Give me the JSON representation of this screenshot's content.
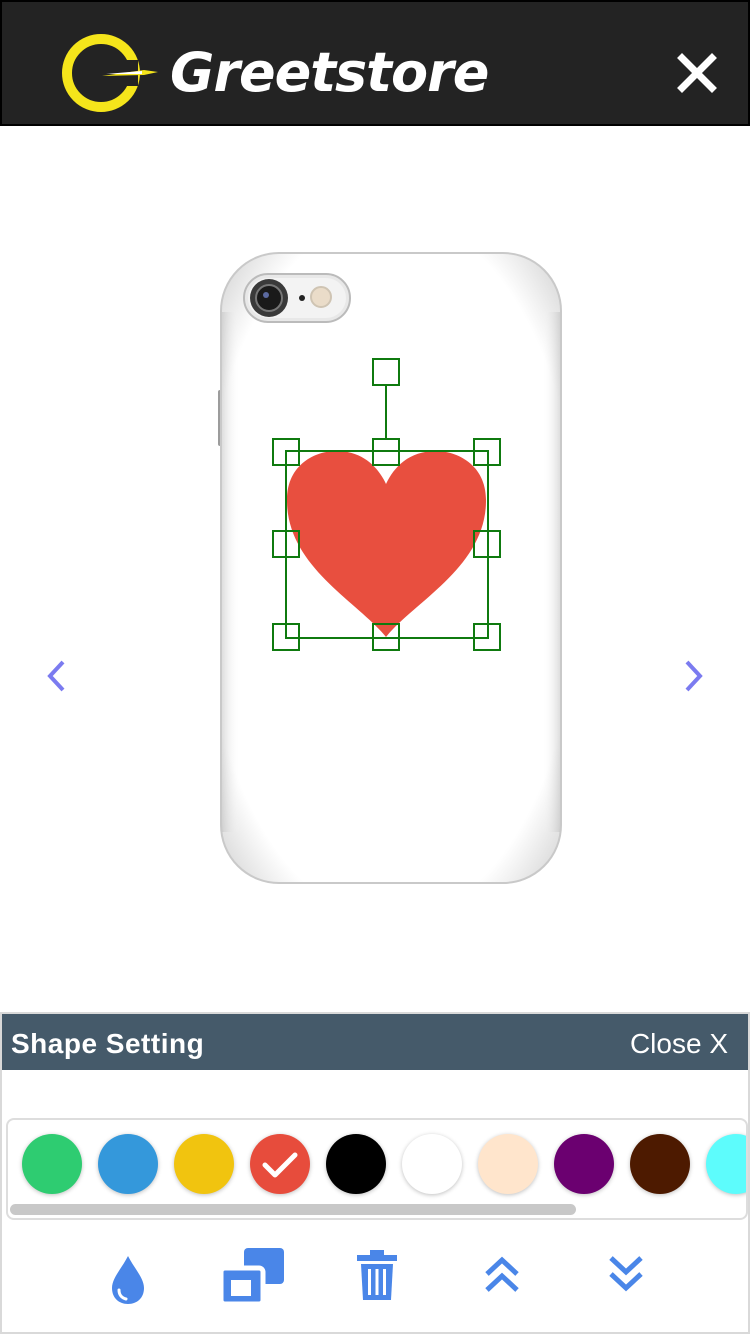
{
  "header": {
    "brand": "Greetstore",
    "close_icon": "close-icon"
  },
  "stage": {
    "product": "phone-case",
    "selected_shape": "heart",
    "shape_color": "#e84f3f",
    "selection_color": "#0f7a0f"
  },
  "panel": {
    "title": "Shape Setting",
    "close_label": "Close X",
    "swatches": [
      {
        "name": "green",
        "color": "#2ecc71"
      },
      {
        "name": "blue",
        "color": "#3498db"
      },
      {
        "name": "yellow",
        "color": "#f1c40f"
      },
      {
        "name": "red",
        "color": "#e74c3c",
        "selected": true
      },
      {
        "name": "black",
        "color": "#000000"
      },
      {
        "name": "white",
        "color": "#ffffff"
      },
      {
        "name": "bisque",
        "color": "#ffe5cc"
      },
      {
        "name": "purple",
        "color": "#6b0070"
      },
      {
        "name": "brown",
        "color": "#4d1a00"
      },
      {
        "name": "cyan",
        "color": "#5dfcfc"
      }
    ],
    "tools": [
      {
        "name": "fill-color-tool",
        "icon": "droplet-icon"
      },
      {
        "name": "duplicate-tool",
        "icon": "duplicate-icon"
      },
      {
        "name": "delete-tool",
        "icon": "trash-icon"
      },
      {
        "name": "bring-forward-tool",
        "icon": "chevrons-up-icon"
      },
      {
        "name": "send-backward-tool",
        "icon": "chevrons-down-icon"
      }
    ],
    "accent": "#4a86e8"
  }
}
